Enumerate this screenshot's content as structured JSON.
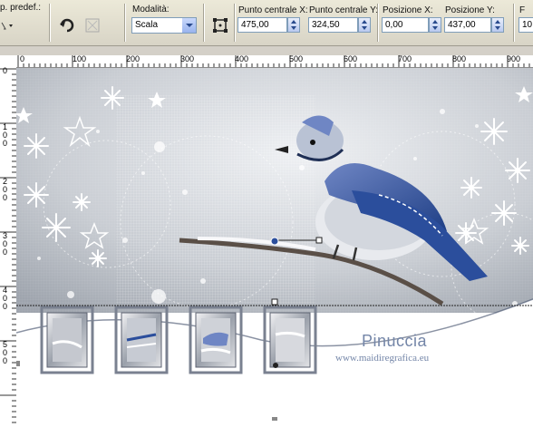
{
  "toolbar": {
    "preset_label": "p. predef.:",
    "mode_label": "Modalità:",
    "mode_value": "Scala",
    "center_x_label": "Punto centrale X:",
    "center_x_value": "475,00",
    "center_y_label": "Punto centrale Y:",
    "center_y_value": "324,50",
    "pos_x_label": "Posizione X:",
    "pos_x_value": "0,00",
    "pos_y_label": "Posizione Y:",
    "pos_y_value": "437,00",
    "extra_label": "F",
    "extra_value": "10"
  },
  "ruler": {
    "h_ticks": [
      "0",
      "100",
      "200",
      "300",
      "400",
      "500",
      "600",
      "700",
      "800",
      "900"
    ],
    "v_ticks": [
      "0",
      "1\n0\n0",
      "2\n0\n0",
      "3\n0\n0",
      "4\n0\n0",
      "5\n0\n0"
    ]
  },
  "canvas": {
    "watermark_name": "Pinuccia",
    "watermark_url": "www.maidiregrafica.eu"
  },
  "colors": {
    "accent": "#4a6fb0",
    "watermark": "#7486a8"
  }
}
